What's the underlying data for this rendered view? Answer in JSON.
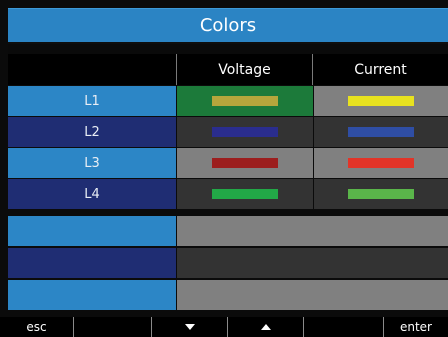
{
  "title": "Colors",
  "columns": {
    "voltage": "Voltage",
    "current": "Current"
  },
  "rows": [
    {
      "label": "L1",
      "voltage_color": "#b5a63c",
      "current_color": "#e8e21f"
    },
    {
      "label": "L2",
      "voltage_color": "#2a2d8e",
      "current_color": "#2f4ea5"
    },
    {
      "label": "L3",
      "voltage_color": "#9c1e1e",
      "current_color": "#e23428"
    },
    {
      "label": "L4",
      "voltage_color": "#22a847",
      "current_color": "#5ab54a"
    }
  ],
  "footer": {
    "esc": "esc",
    "enter": "enter",
    "down_icon": "arrow-down-icon",
    "up_icon": "arrow-up-icon"
  },
  "colors": {
    "title_blue": "#2b84c4",
    "label_light": "#2c86c6",
    "label_dark": "#1f2d73",
    "selected": "#1c7a3a"
  }
}
